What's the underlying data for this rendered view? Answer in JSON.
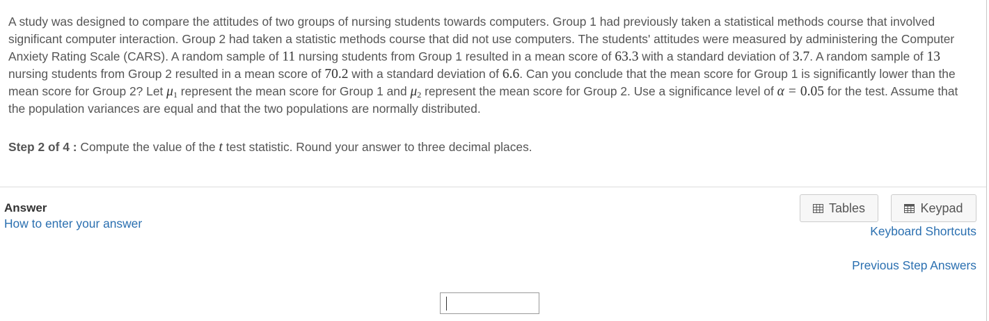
{
  "problem": {
    "p1": "A study was designed to compare the attitudes of two groups of nursing students towards computers.  Group 1 had previously taken a statistical methods course that involved significant computer interaction.  Group 2 had taken a statistic methods course that did not use computers.  The students' attitudes were measured by administering the Computer Anxiety Rating Scale (CARS).  A random sample of ",
    "n1": "11",
    "p2": " nursing students from Group 1 resulted in a mean score of ",
    "mean1": "63.3",
    "p3": " with a standard deviation of ",
    "sd1": "3.7",
    "p4": ".  A random sample of ",
    "n2": "13",
    "p5": " nursing students from Group 2 resulted in a mean score of ",
    "mean2": "70.2",
    "p6": " with a standard deviation of ",
    "sd2": "6.6",
    "p7": ".  Can you conclude that the mean score for Group 1 is significantly lower than the mean score for Group 2?  Let ",
    "mu_symbol": "μ",
    "sub1": "1",
    "p8": " represent the mean score for Group 1 and ",
    "sub2": "2",
    "p9": " represent the mean score for Group 2.  Use a significance level of ",
    "alpha_symbol": "α",
    "equals": "=",
    "alpha_value": "0.05",
    "p10": " for the test.  Assume that the population variances are equal and that the two populations are normally distributed."
  },
  "step": {
    "label": "Step 2 of 4 :",
    "text_before": " Compute the value of the ",
    "t_symbol": "t",
    "text_after": " test statistic. Round your answer to three decimal places."
  },
  "answer": {
    "label": "Answer",
    "how_to_link": "How to enter your answer",
    "input_value": ""
  },
  "toolbar": {
    "tables_label": "Tables",
    "keypad_label": "Keypad",
    "tables_icon": "table-grid-icon",
    "keypad_icon": "keypad-grid-icon"
  },
  "links": {
    "keyboard_shortcuts": "Keyboard Shortcuts",
    "previous_step_answers": "Previous Step Answers"
  },
  "colors": {
    "link": "#2a6fb0",
    "text": "#555555",
    "divider": "#dddddd"
  }
}
